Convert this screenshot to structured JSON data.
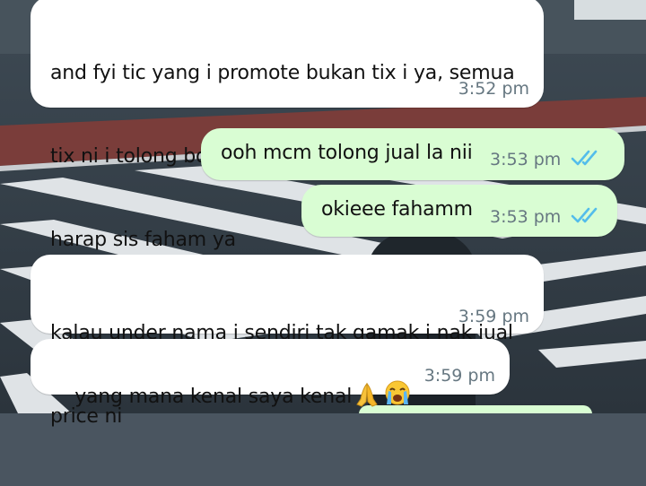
{
  "theme": {
    "incoming_bubble_color": "#ffffff",
    "outgoing_bubble_color": "#d9fdd3",
    "read_tick_color": "#53bdeb",
    "timestamp_color": "#667781"
  },
  "messages": [
    {
      "direction": "incoming",
      "lines": [
        "and fyi tic yang i promote bukan tix i ya, semua",
        "tix ni i tolong boss i and cari duit tepi sikit.",
        "harap sis faham ya"
      ],
      "time": "3:52 pm"
    },
    {
      "direction": "outgoing",
      "lines": [
        "ooh mcm tolong jual la nii"
      ],
      "time": "3:53 pm",
      "status_icon": "double-check-read-icon"
    },
    {
      "direction": "outgoing",
      "lines": [
        "okieee fahamm"
      ],
      "time": "3:53 pm",
      "status_icon": "double-check-read-icon"
    },
    {
      "direction": "incoming",
      "lines": [
        "kalau under nama i sendiri tak gamak i nak jual",
        "price ni"
      ],
      "time": "3:59 pm"
    },
    {
      "direction": "incoming",
      "lines": [
        "yang mana kenal saya kenal"
      ],
      "emojis": [
        "folded-hands-emoji",
        "loudly-crying-face-emoji"
      ],
      "time": "3:59 pm"
    }
  ]
}
